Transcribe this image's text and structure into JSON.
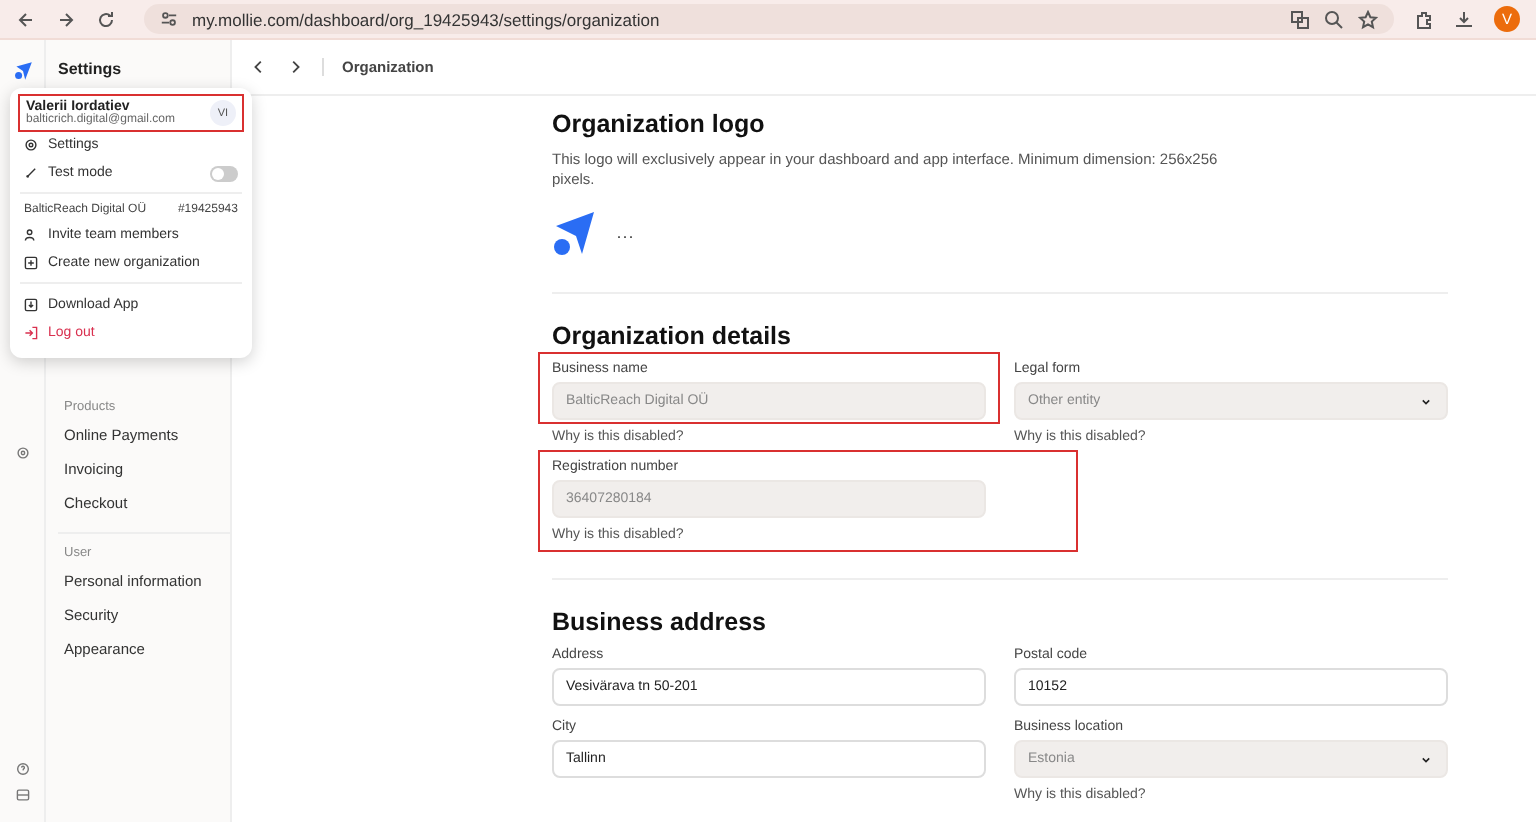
{
  "browser": {
    "url": "my.mollie.com/dashboard/org_19425943/settings/organization",
    "avatar": "V"
  },
  "sidebar": {
    "title": "Settings",
    "sections": [
      {
        "heading": "Products",
        "items": [
          "Online Payments",
          "Invoicing",
          "Checkout"
        ]
      },
      {
        "heading": "User",
        "items": [
          "Personal information",
          "Security",
          "Appearance"
        ]
      }
    ]
  },
  "topbar": {
    "breadcrumb": "Organization"
  },
  "account_menu": {
    "user": {
      "name": "Valerii Iordatiev",
      "email": "balticrich.digital@gmail.com",
      "initials": "VI",
      "highlighted": true
    },
    "items": [
      {
        "kind": "link",
        "label": "Settings"
      },
      {
        "kind": "toggle",
        "label": "Test mode",
        "on": false
      }
    ],
    "organization": {
      "name": "BalticReach Digital OÜ",
      "id": "#19425943"
    },
    "org_items": [
      {
        "kind": "people",
        "label": "Invite team members"
      },
      {
        "kind": "plus",
        "label": "Create new organization"
      }
    ],
    "bottom_items": [
      {
        "kind": "download",
        "label": "Download App"
      },
      {
        "kind": "logout",
        "label": "Log out"
      }
    ]
  },
  "logo_section": {
    "title": "Organization logo",
    "description": "This logo will exclusively appear in your dashboard and app interface. Minimum dimension: 256x256 pixels.",
    "more": "···"
  },
  "details": {
    "title": "Organization details",
    "fields": [
      {
        "kind": "text",
        "label": "Business name",
        "value": "BalticReach Digital OÜ",
        "disabled": true,
        "highlighted": true,
        "hint": "Why is this disabled?"
      },
      {
        "kind": "select",
        "label": "Legal form",
        "value": "Other entity",
        "disabled": true,
        "highlighted": false,
        "hint": "Why is this disabled?"
      },
      {
        "kind": "text",
        "label": "Registration number",
        "value": "36407280184",
        "disabled": true,
        "highlighted": true,
        "hint": "Why is this disabled?"
      }
    ]
  },
  "address": {
    "title": "Business address",
    "fields": [
      {
        "kind": "text",
        "label": "Address",
        "value": "Vesivärava tn 50-201",
        "disabled": false,
        "highlighted": false
      },
      {
        "kind": "text",
        "label": "Postal code",
        "value": "10152",
        "disabled": false,
        "highlighted": false
      },
      {
        "kind": "text",
        "label": "City",
        "value": "Tallinn",
        "disabled": false,
        "highlighted": false
      },
      {
        "kind": "select",
        "label": "Business location",
        "value": "Estonia",
        "disabled": true,
        "highlighted": false,
        "hint": "Why is this disabled?"
      }
    ]
  }
}
